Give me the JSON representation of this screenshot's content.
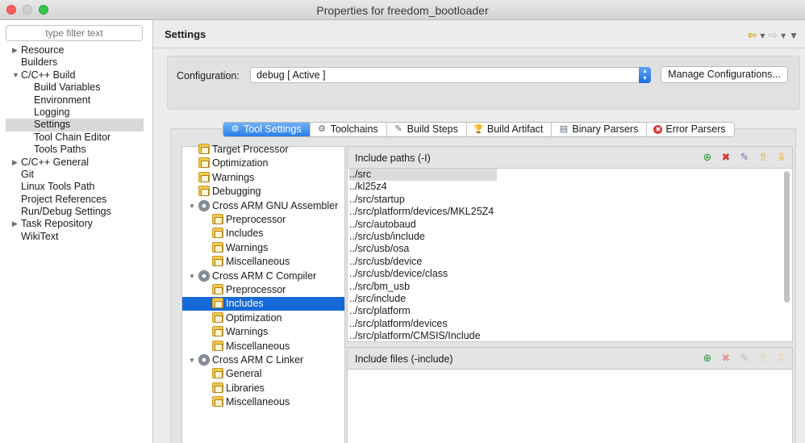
{
  "window": {
    "title": "Properties for freedom_bootloader"
  },
  "left": {
    "filter_placeholder": "type filter text",
    "items": [
      {
        "label": "Resource",
        "level": 0,
        "expander": "▶"
      },
      {
        "label": "Builders",
        "level": 0,
        "expander": ""
      },
      {
        "label": "C/C++ Build",
        "level": 0,
        "expander": "▼"
      },
      {
        "label": "Build Variables",
        "level": 1,
        "expander": ""
      },
      {
        "label": "Environment",
        "level": 1,
        "expander": ""
      },
      {
        "label": "Logging",
        "level": 1,
        "expander": ""
      },
      {
        "label": "Settings",
        "level": 1,
        "expander": "",
        "selected": true
      },
      {
        "label": "Tool Chain Editor",
        "level": 1,
        "expander": ""
      },
      {
        "label": "Tools Paths",
        "level": 1,
        "expander": ""
      },
      {
        "label": "C/C++ General",
        "level": 0,
        "expander": "▶"
      },
      {
        "label": "Git",
        "level": 0,
        "expander": ""
      },
      {
        "label": "Linux Tools Path",
        "level": 0,
        "expander": ""
      },
      {
        "label": "Project References",
        "level": 0,
        "expander": ""
      },
      {
        "label": "Run/Debug Settings",
        "level": 0,
        "expander": ""
      },
      {
        "label": "Task Repository",
        "level": 0,
        "expander": "▶"
      },
      {
        "label": "WikiText",
        "level": 0,
        "expander": ""
      }
    ]
  },
  "header": {
    "title": "Settings",
    "nav_icons": [
      "back-arrow-icon",
      "forward-arrow-icon",
      "view-menu-icon"
    ]
  },
  "config": {
    "label": "Configuration:",
    "value": "debug  [ Active ]",
    "manage_label": "Manage Configurations..."
  },
  "tabs": [
    {
      "label": "Tool Settings",
      "icon": "tool-settings-icon",
      "glyph": "⚙",
      "active": true
    },
    {
      "label": "Toolchains",
      "icon": "toolchains-icon",
      "glyph": "⚙"
    },
    {
      "label": "Build Steps",
      "icon": "build-steps-icon",
      "glyph": "✎"
    },
    {
      "label": "Build Artifact",
      "icon": "build-artifact-icon",
      "glyph": "🏆"
    },
    {
      "label": "Binary Parsers",
      "icon": "binary-parsers-icon",
      "glyph": "▤"
    },
    {
      "label": "Error Parsers",
      "icon": "error-parsers-icon",
      "glyph": "✖"
    }
  ],
  "tool_tree": [
    {
      "label": "Target Processor",
      "kind": "folder",
      "level": 0
    },
    {
      "label": "Optimization",
      "kind": "folder",
      "level": 0
    },
    {
      "label": "Warnings",
      "kind": "folder",
      "level": 0
    },
    {
      "label": "Debugging",
      "kind": "folder",
      "level": 0
    },
    {
      "label": "Cross ARM GNU Assembler",
      "kind": "tool",
      "level": 0,
      "expander": "▼"
    },
    {
      "label": "Preprocessor",
      "kind": "folder",
      "level": 1
    },
    {
      "label": "Includes",
      "kind": "folder",
      "level": 1
    },
    {
      "label": "Warnings",
      "kind": "folder",
      "level": 1
    },
    {
      "label": "Miscellaneous",
      "kind": "folder",
      "level": 1
    },
    {
      "label": "Cross ARM C Compiler",
      "kind": "tool",
      "level": 0,
      "expander": "▼"
    },
    {
      "label": "Preprocessor",
      "kind": "folder",
      "level": 1
    },
    {
      "label": "Includes",
      "kind": "folder",
      "level": 1,
      "selected": true
    },
    {
      "label": "Optimization",
      "kind": "folder",
      "level": 1
    },
    {
      "label": "Warnings",
      "kind": "folder",
      "level": 1
    },
    {
      "label": "Miscellaneous",
      "kind": "folder",
      "level": 1
    },
    {
      "label": "Cross ARM C Linker",
      "kind": "tool",
      "level": 0,
      "expander": "▼"
    },
    {
      "label": "General",
      "kind": "folder",
      "level": 1
    },
    {
      "label": "Libraries",
      "kind": "folder",
      "level": 1
    },
    {
      "label": "Miscellaneous",
      "kind": "folder",
      "level": 1
    }
  ],
  "include_paths": {
    "title": "Include paths (-I)",
    "tools": [
      "add-icon",
      "delete-icon",
      "edit-icon",
      "move-up-icon",
      "move-down-icon"
    ],
    "rows": [
      "../src",
      "../kl25z4",
      "../src/startup",
      "../src/platform/devices/MKL25Z4",
      "../src/autobaud",
      "../src/usb/include",
      "../src/usb/osa",
      "../src/usb/device",
      "../src/usb/device/class",
      "../src/bm_usb",
      "../src/include",
      "../src/platform",
      "../src/platform/devices",
      "../src/platform/CMSIS/Include"
    ]
  },
  "include_files": {
    "title": "Include files (-include)",
    "tools": [
      "add-icon",
      "delete-icon",
      "edit-icon",
      "move-up-icon",
      "move-down-icon"
    ],
    "rows": []
  }
}
